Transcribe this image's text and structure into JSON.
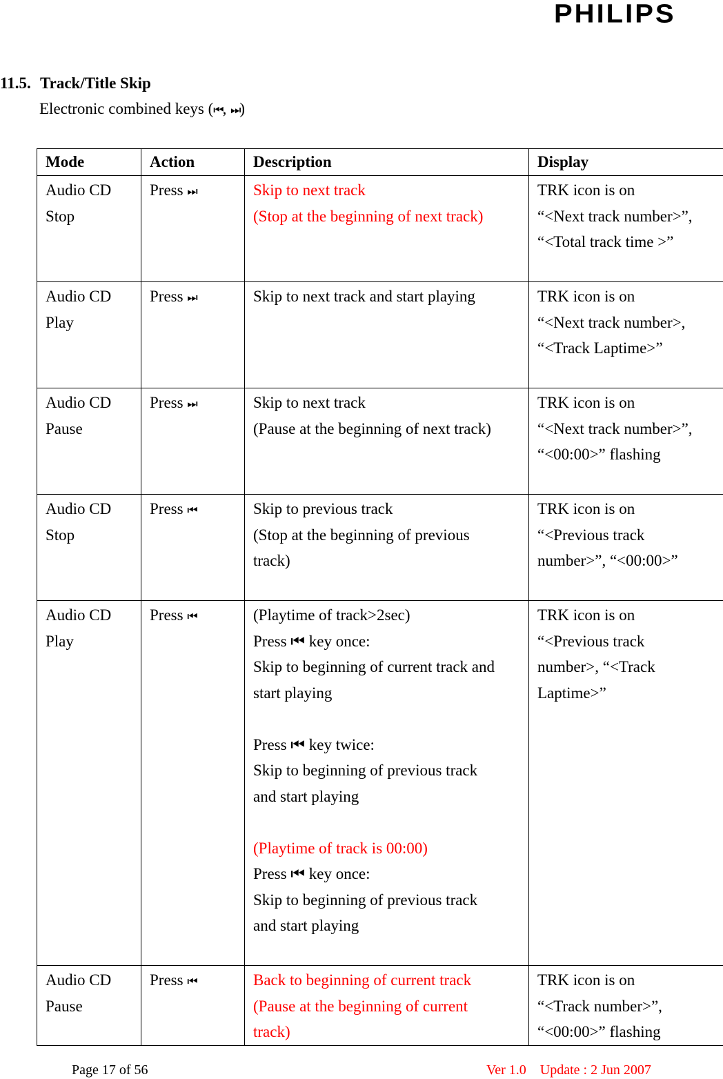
{
  "header": {
    "logo": "PHILIPS"
  },
  "section": {
    "number": "11.5.",
    "title": "Track/Title Skip",
    "subtitle_prefix": "Electronic combined keys (",
    "subtitle_sep": ", ",
    "subtitle_suffix": ")",
    "icons": {
      "prev": "⏮",
      "next": "⏭"
    }
  },
  "table": {
    "headers": [
      "Mode",
      "Action",
      "Description",
      "Display"
    ],
    "rows": [
      {
        "mode": [
          "Audio CD",
          "Stop"
        ],
        "action": "Press",
        "action_icon": "⏭",
        "description": [
          {
            "text": "Skip to next track",
            "red": true
          },
          {
            "text": "(Stop at the beginning of next track)",
            "red": true
          }
        ],
        "display": [
          "TRK icon is on",
          "“<Next track number>”,",
          "“<Total track time >”"
        ]
      },
      {
        "mode": [
          "Audio CD",
          "Play"
        ],
        "action": "Press",
        "action_icon": "⏭",
        "description": [
          {
            "text": "Skip to next track and start playing",
            "red": false
          }
        ],
        "display": [
          "TRK icon is on",
          "“<Next track number>,",
          "“<Track Laptime>”"
        ]
      },
      {
        "mode": [
          "Audio CD",
          "Pause"
        ],
        "action": "Press",
        "action_icon": "⏭",
        "description": [
          {
            "text": "Skip to next track",
            "red": false
          },
          {
            "text": "(Pause at the beginning of next track)",
            "red": false
          }
        ],
        "display": [
          "TRK icon is on",
          "“<Next track number>”,",
          "“<00:00>” flashing"
        ]
      },
      {
        "mode": [
          "Audio CD",
          "Stop"
        ],
        "action": "Press",
        "action_icon": "⏮",
        "description": [
          {
            "text": "Skip to previous track",
            "red": false
          },
          {
            "text": "(Stop at the beginning of previous",
            "red": false
          },
          {
            "text": "track)",
            "red": false
          }
        ],
        "display": [
          "TRK icon is on",
          "“<Previous track",
          "number>”, “<00:00>”"
        ]
      },
      {
        "mode": [
          "Audio CD",
          "Play"
        ],
        "action": "Press",
        "action_icon": "⏮",
        "description": [
          {
            "text": "(Playtime of track>2sec)",
            "red": false
          },
          {
            "text": "Press ⏮ key once:",
            "red": false
          },
          {
            "text": "Skip to beginning of current track and",
            "red": false
          },
          {
            "text": "start playing",
            "red": false
          },
          {
            "text": "",
            "red": false
          },
          {
            "text": "Press ⏮ key twice:",
            "red": false
          },
          {
            "text": "Skip to beginning of previous track",
            "red": false
          },
          {
            "text": "and start playing",
            "red": false
          },
          {
            "text": "",
            "red": false
          },
          {
            "text": "(Playtime of track is 00:00)",
            "red": true
          },
          {
            "text": "Press ⏮ key once:",
            "red": false
          },
          {
            "text": "Skip to beginning of previous track",
            "red": false
          },
          {
            "text": "and start playing",
            "red": false
          }
        ],
        "display": [
          "TRK icon is on",
          "“<Previous track",
          "number>, “<Track",
          "Laptime>”"
        ]
      },
      {
        "mode": [
          "Audio CD",
          "Pause"
        ],
        "action": "Press",
        "action_icon": "⏮",
        "description": [
          {
            "text": "Back to beginning of current track",
            "red": true
          },
          {
            "text": "(Pause at the beginning of current",
            "red": true
          },
          {
            "text": "track)",
            "red": true
          }
        ],
        "display": [
          "TRK icon is on",
          "“<Track number>”,",
          "“<00:00>” flashing"
        ]
      }
    ]
  },
  "footer": {
    "page": "Page 17 of 56",
    "version": "Ver 1.0    Update : 2 Jun 2007"
  },
  "colors": {
    "highlight": "#ff0000",
    "text": "#000000"
  }
}
